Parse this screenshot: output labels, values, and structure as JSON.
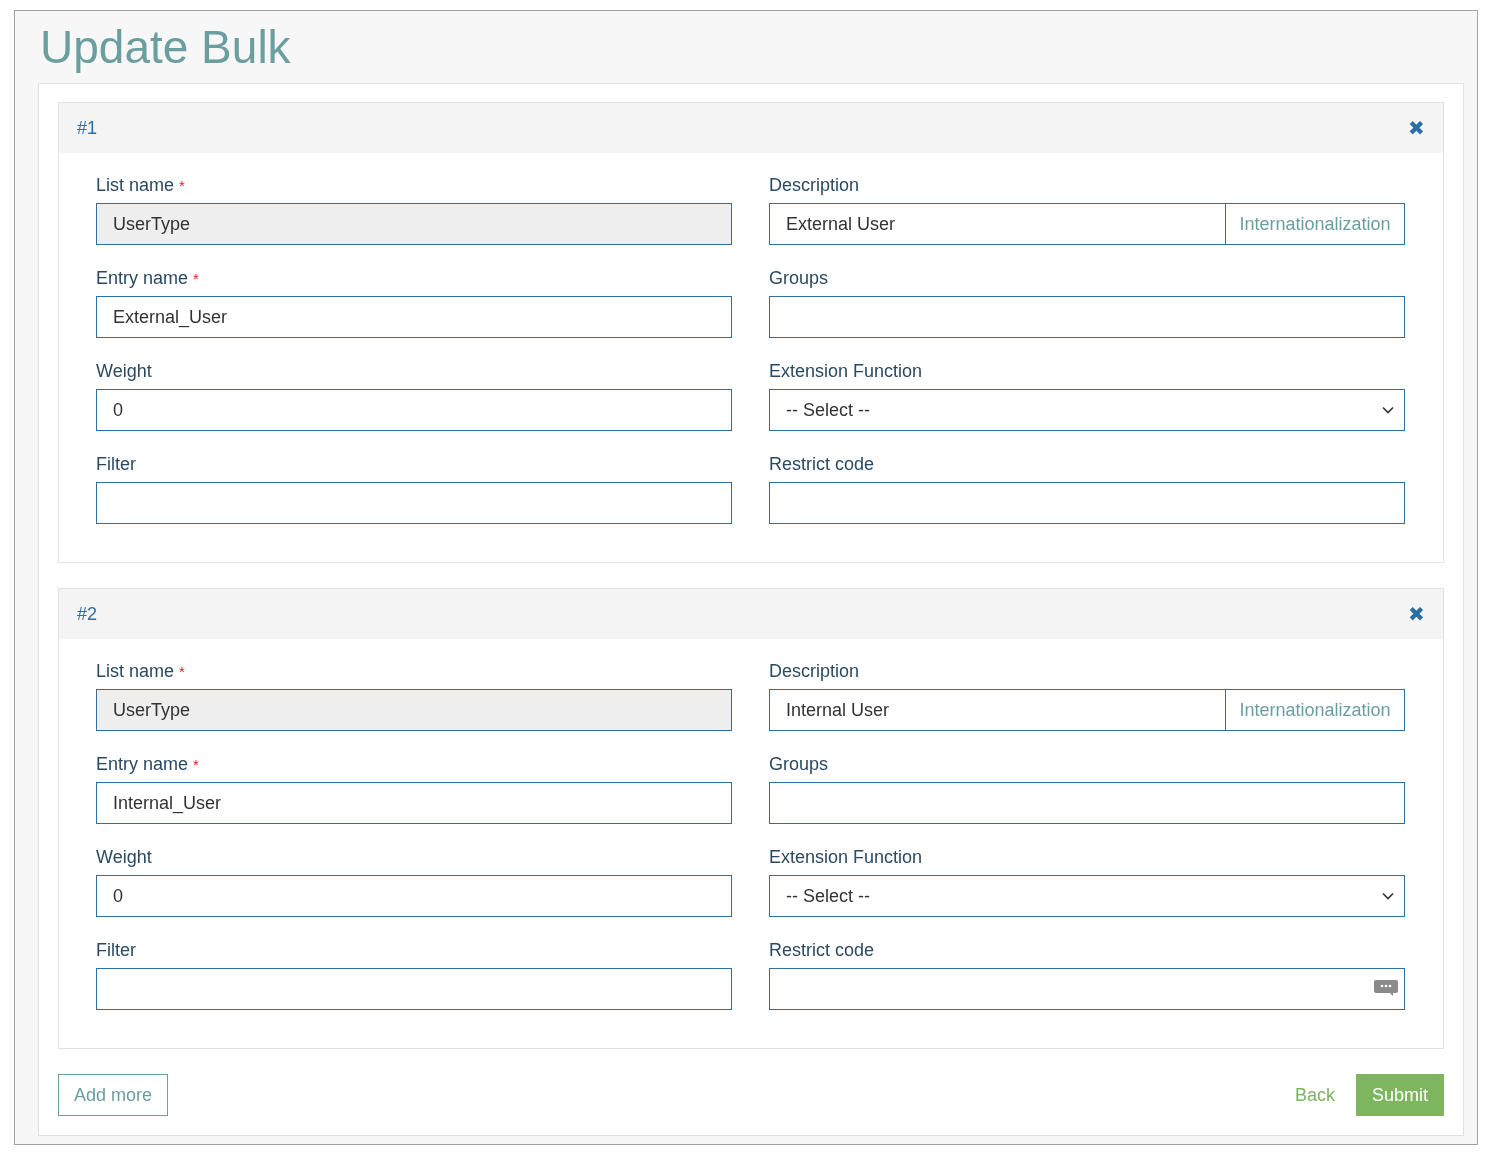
{
  "title": "Update Bulk",
  "entries": [
    {
      "heading": "#1",
      "close_icon": "✖",
      "fields": [
        {
          "kind": "text",
          "label": "List name",
          "required": true,
          "value": "UserType",
          "disabled": true
        },
        {
          "kind": "text_button",
          "label": "Description",
          "required": false,
          "value": "External User",
          "disabled": false,
          "button": "Internationalization"
        },
        {
          "kind": "text",
          "label": "Entry name",
          "required": true,
          "value": "External_User",
          "disabled": false
        },
        {
          "kind": "text",
          "label": "Groups",
          "required": false,
          "disabled": false
        },
        {
          "kind": "text",
          "label": "Weight",
          "required": false,
          "value": "0",
          "disabled": false
        },
        {
          "kind": "select",
          "label": "Extension Function",
          "required": false,
          "value": "-- Select --",
          "disabled": false
        },
        {
          "kind": "text",
          "label": "Filter",
          "required": false,
          "disabled": false
        },
        {
          "kind": "text",
          "label": "Restrict code",
          "required": false,
          "disabled": false
        }
      ]
    },
    {
      "heading": "#2",
      "close_icon": "✖",
      "fields": [
        {
          "kind": "text",
          "label": "List name",
          "required": true,
          "value": "UserType",
          "disabled": true
        },
        {
          "kind": "text_button",
          "label": "Description",
          "required": false,
          "value": "Internal User",
          "disabled": false,
          "button": "Internationalization"
        },
        {
          "kind": "text",
          "label": "Entry name",
          "required": true,
          "value": "Internal_User",
          "disabled": false
        },
        {
          "kind": "text",
          "label": "Groups",
          "required": false,
          "disabled": false
        },
        {
          "kind": "text",
          "label": "Weight",
          "required": false,
          "value": "0",
          "disabled": false
        },
        {
          "kind": "select",
          "label": "Extension Function",
          "required": false,
          "value": "-- Select --",
          "disabled": false
        },
        {
          "kind": "text",
          "label": "Filter",
          "required": false,
          "disabled": false
        },
        {
          "kind": "text_icon",
          "label": "Restrict code",
          "required": false,
          "disabled": false
        }
      ]
    }
  ],
  "required_mark": "*",
  "add_button": "Add more",
  "back_link": "Back",
  "submit_button": "Submit"
}
